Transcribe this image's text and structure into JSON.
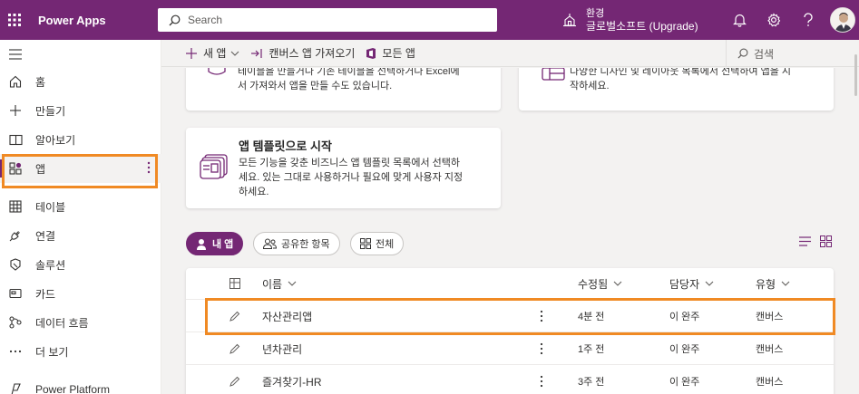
{
  "topbar": {
    "app_name": "Power Apps",
    "search_placeholder": "Search",
    "env_label": "환경",
    "env_name": "글로벌소프트 (Upgrade)"
  },
  "nav": {
    "items": [
      {
        "label": "홈",
        "icon": "home-icon"
      },
      {
        "label": "만들기",
        "icon": "plus-icon"
      },
      {
        "label": "알아보기",
        "icon": "book-icon"
      },
      {
        "label": "앱",
        "icon": "apps-icon"
      },
      {
        "label": "테이블",
        "icon": "table-icon"
      },
      {
        "label": "연결",
        "icon": "plug-icon"
      },
      {
        "label": "솔루션",
        "icon": "solution-icon"
      },
      {
        "label": "카드",
        "icon": "card-icon"
      },
      {
        "label": "데이터 흐름",
        "icon": "flow-icon"
      },
      {
        "label": "더 보기",
        "icon": "more-icon"
      },
      {
        "label": "Power Platform",
        "icon": "power-platform-icon"
      }
    ]
  },
  "cmdbar": {
    "new_app": "새 앱",
    "import_canvas": "캔버스 앱 가져오기",
    "all_apps": "모든 앱",
    "search": "검색"
  },
  "cards": {
    "card1_text": "테이블을 만들거나 기존 테이블을 선택하거나 Excel에서 가져와서 앱을 만들 수도 있습니다.",
    "card1_line1": "테이블을 만들거나 기존 테이블을 선택하거나 Excel에",
    "card1_line2": "서 가져와서 앱을 만들 수도 있습니다.",
    "card2_line1": "다양한 디자인 및 레이아웃 목록에서 선택하여 앱을 시",
    "card2_line2": "작하세요.",
    "template_title": "앱 템플릿으로 시작",
    "template_line1": "모든 기능을 갖춘 비즈니스 앱 템플릿 목록에서 선택하",
    "template_line2": "세요. 있는 그대로 사용하거나 필요에 맞게 사용자 지정",
    "template_line3": "하세요."
  },
  "filters": {
    "my_apps": "내 앱",
    "shared": "공유한 항목",
    "all": "전체"
  },
  "table": {
    "headers": {
      "name": "이름",
      "modified": "수정됨",
      "owner": "담당자",
      "type": "유형"
    },
    "rows": [
      {
        "name": "자산관리앱",
        "modified": "4분 전",
        "owner": "이 완주",
        "type": "캔버스"
      },
      {
        "name": "년차관리",
        "modified": "1주 전",
        "owner": "이 완주",
        "type": "캔버스"
      },
      {
        "name": "즐겨찾기-HR",
        "modified": "3주 전",
        "owner": "이 완주",
        "type": "캔버스"
      }
    ]
  },
  "colors": {
    "brand": "#742774",
    "highlight": "#f08a24"
  }
}
